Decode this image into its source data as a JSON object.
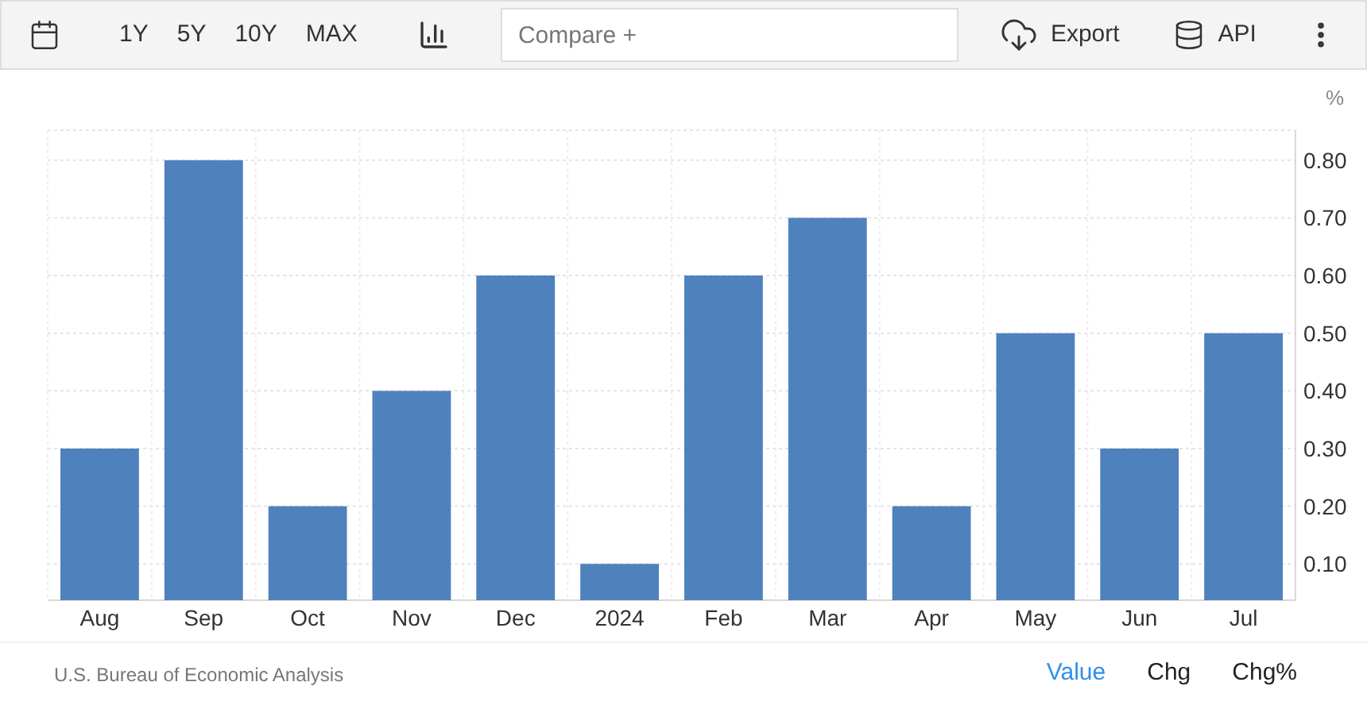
{
  "toolbar": {
    "ranges": [
      "1Y",
      "5Y",
      "10Y",
      "MAX"
    ],
    "compare": {
      "placeholder": "Compare +"
    },
    "export_label": "Export",
    "api_label": "API"
  },
  "chart": {
    "chart_data": {
      "type": "bar",
      "ylabel": "%",
      "categories": [
        "Aug",
        "Sep",
        "Oct",
        "Nov",
        "Dec",
        "2024",
        "Feb",
        "Mar",
        "Apr",
        "May",
        "Jun",
        "Jul"
      ],
      "grid": true,
      "series": [
        {
          "color": "#4f81bd",
          "values": [
            0.3,
            0.8,
            0.2,
            0.4,
            0.6,
            0.1,
            0.6,
            0.7,
            0.2,
            0.5,
            0.3,
            0.5
          ]
        }
      ],
      "ylim": [
        0.037,
        0.852
      ],
      "yticks": [
        {
          "value": 0.1,
          "label": "0.10"
        },
        {
          "value": 0.2,
          "label": "0.20"
        },
        {
          "value": 0.3,
          "label": "0.30"
        },
        {
          "value": 0.4,
          "label": "0.40"
        },
        {
          "value": 0.5,
          "label": "0.50"
        },
        {
          "value": 0.6,
          "label": "0.60"
        },
        {
          "value": 0.7,
          "label": "0.70"
        },
        {
          "value": 0.8,
          "label": "0.80"
        }
      ]
    }
  },
  "footer": {
    "source": "U.S. Bureau of Economic Analysis",
    "modes": [
      {
        "label": "Value",
        "selected": true
      },
      {
        "label": "Chg",
        "selected": false
      },
      {
        "label": "Chg%",
        "selected": false
      }
    ]
  }
}
